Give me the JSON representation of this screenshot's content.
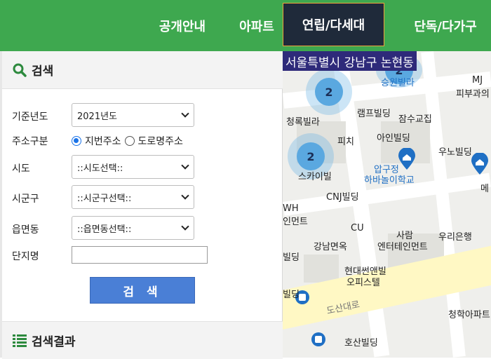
{
  "top_nav": {
    "items": [
      {
        "label": "공개안내"
      },
      {
        "label": "아파트"
      },
      {
        "label": "연립/다세대"
      },
      {
        "label": "단독/다가구"
      }
    ]
  },
  "search_panel": {
    "title": "검색",
    "fields": {
      "year_label": "기준년도",
      "year_value": "2021년도",
      "address_type_label": "주소구분",
      "address_option_lot": "지번주소",
      "address_option_road": "도로명주소",
      "sido_label": "시도",
      "sido_value": "::시도선택::",
      "sigungu_label": "시군구",
      "sigungu_value": "::시군구선택::",
      "eupmyeondong_label": "읍면동",
      "eupmyeondong_value": "::읍면동선택::",
      "complex_label": "단지명",
      "complex_value": ""
    },
    "search_button": "검 색",
    "results_title": "검색결과"
  },
  "map": {
    "region": "서울특별시 강남구 논현동",
    "clusters": [
      {
        "count": "2"
      },
      {
        "count": "2"
      },
      {
        "count": "2"
      }
    ],
    "labels": {
      "venhill": "승원빌라",
      "mj": "MJ",
      "skin": "피부과의",
      "cheongrok": "청록빌라",
      "ramp": "램프빌딩",
      "jamsu": "잠수교집",
      "pizza": "피치",
      "ain": "아인빌딩",
      "unoble": "우노빌딩",
      "apgujeong": "압구정",
      "habanoi": "하바놀이학교",
      "me": "메",
      "skybill": "스카이빌",
      "cnj": "CNJ빌딩",
      "wh": "WH",
      "ent": "인먼트",
      "cu": "CU",
      "saram": "사람",
      "saram_ent": "엔터테인먼트",
      "woori": "우리은행",
      "gangnam": "강남면옥",
      "sun": "빌딩",
      "hyundai": "현대썬앤빌",
      "officetel": "오피스텔",
      "road": "도산대로",
      "cheongha": "청학아파트",
      "hosan": "호산빌딩",
      "ding": "빌딩"
    }
  },
  "colors": {
    "header_green": "#3ea84f",
    "active_tab": "#1f2a3a",
    "active_border": "#f0a43c",
    "search_button": "#4a7fd6",
    "region_bar": "#2e2a7a",
    "cluster": "#5aa8e0"
  }
}
